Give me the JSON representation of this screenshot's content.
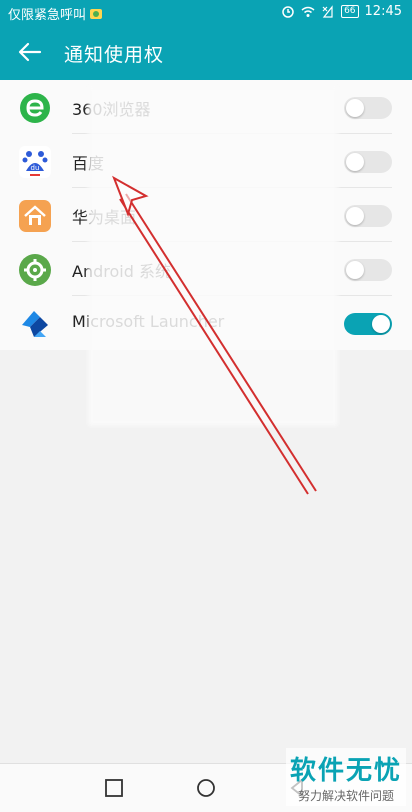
{
  "status_bar": {
    "left_text": "仅限紧急呼叫",
    "battery": "66",
    "time": "12:45"
  },
  "app_bar": {
    "title": "通知使用权"
  },
  "apps": [
    {
      "label": "360浏览器",
      "icon": "360-browser-icon",
      "enabled": false
    },
    {
      "label": "百度",
      "icon": "baidu-icon",
      "enabled": false
    },
    {
      "label": "华为桌面",
      "icon": "huawei-home-icon",
      "enabled": false
    },
    {
      "label": "Android 系统",
      "icon": "android-settings-icon",
      "enabled": false
    },
    {
      "label": "Microsoft Launcher",
      "icon": "microsoft-launcher-icon",
      "enabled": true
    }
  ],
  "watermark": {
    "main": "软件无忧",
    "sub": "努力解决软件问题"
  },
  "colors": {
    "accent": "#0aa3b4",
    "arrow": "#d32f2f"
  }
}
